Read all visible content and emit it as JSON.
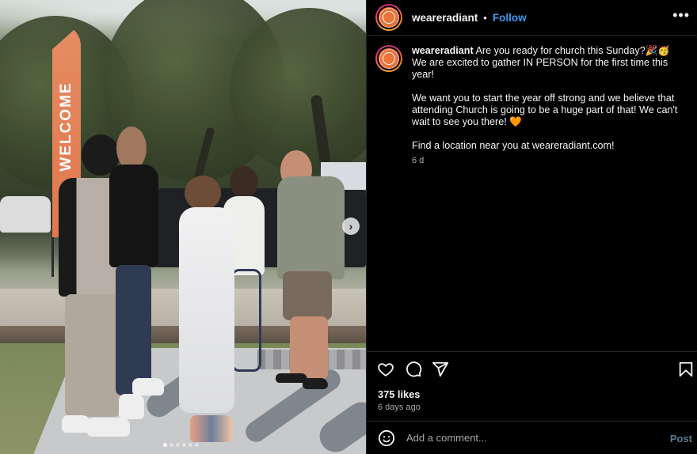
{
  "post": {
    "image": {
      "alt": "Church members greeting each other outdoors next to a WELCOME flag",
      "flag_text": "WELCOME",
      "carousel": {
        "total_slides": 6,
        "active_index": 0
      },
      "next_icon": "chevron-right-icon"
    },
    "header": {
      "username": "weareradiant",
      "separator": "•",
      "follow_label": "Follow",
      "more_icon": "more-horizontal-icon",
      "more_glyph": "•••"
    },
    "caption": {
      "username": "weareradiant",
      "paragraphs": [
        "Are you ready for church this Sunday?🎉🥳 We are excited to gather IN PERSON for the first time this year!",
        "We want you to start the year off strong and we believe that attending Church is going to be a huge part of that! We can't wait to see you there! 🧡",
        "Find a location near you at weareradiant.com!"
      ],
      "age": "6 d"
    },
    "actions": {
      "like_icon": "heart-icon",
      "comment_icon": "comment-icon",
      "share_icon": "send-icon",
      "save_icon": "bookmark-icon"
    },
    "likes_text": "375 likes",
    "timestamp": "6 days ago",
    "comment": {
      "emoji_icon": "smiley-icon",
      "placeholder": "Add a comment...",
      "value": "",
      "post_label": "Post"
    }
  },
  "colors": {
    "accent_blue": "#3d9bf0",
    "brand_orange": "#e8743a",
    "post_disabled": "#587a94",
    "muted_text": "#a8a8a8",
    "divider": "#262626"
  }
}
